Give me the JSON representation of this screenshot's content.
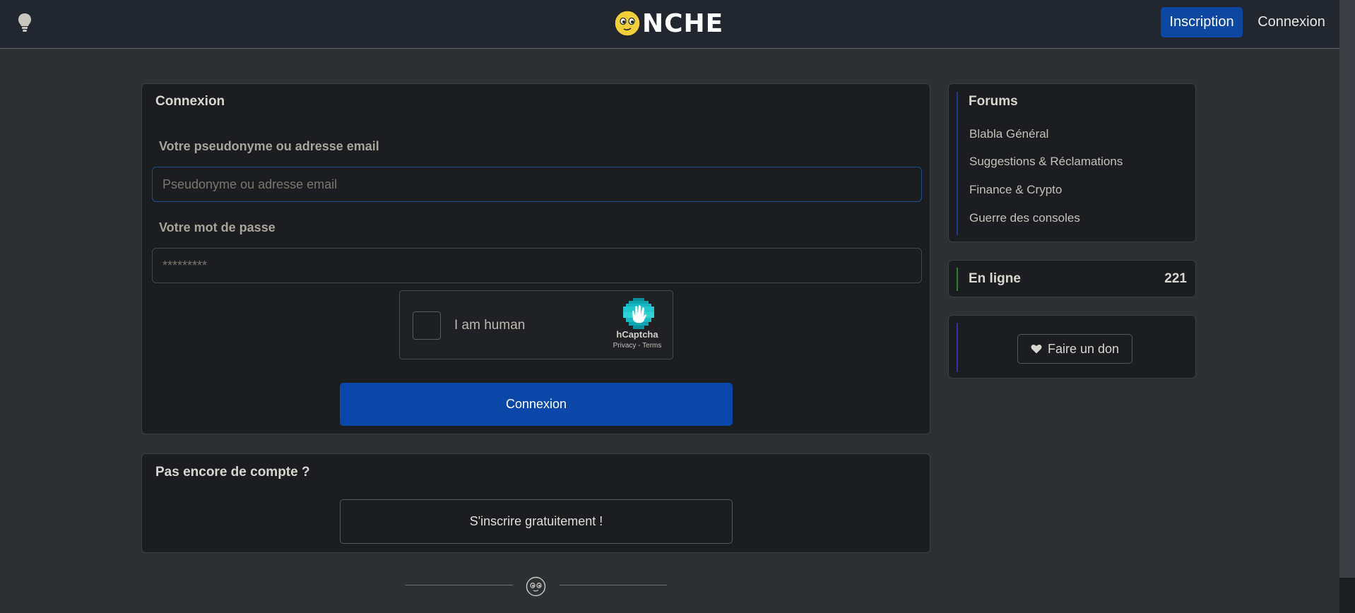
{
  "navbar": {
    "logo_text": "NCHE",
    "signup_label": "Inscription",
    "login_label": "Connexion"
  },
  "login_form": {
    "title": "Connexion",
    "username_label": "Votre pseudonyme ou adresse email",
    "username_placeholder": "Pseudonyme ou adresse email",
    "password_label": "Votre mot de passe",
    "password_placeholder": "*********",
    "submit_label": "Connexion"
  },
  "captcha": {
    "label": "I am human",
    "brand": "hCaptcha",
    "links": "Privacy - Terms"
  },
  "signup_box": {
    "title": "Pas encore de compte ?",
    "button_label": "S'inscrire gratuitement !"
  },
  "sidebar": {
    "forums_title": "Forums",
    "forums": [
      {
        "label": "Blabla Général"
      },
      {
        "label": "Suggestions & Réclamations"
      },
      {
        "label": "Finance & Crypto"
      },
      {
        "label": "Guerre des consoles"
      }
    ],
    "online_label": "En ligne",
    "online_count": "221",
    "donate_label": "Faire un don"
  },
  "colors": {
    "background": "#2e3134",
    "navbar": "#22272f",
    "card": "#1b1d20",
    "primary": "#0b47a8",
    "forums_accent": "#1e3a8a",
    "online_accent": "#2e7d32",
    "donate_accent": "#3730a3"
  },
  "icons": [
    "lightbulb-icon",
    "onche-logo-face-icon",
    "heart-icon",
    "hcaptcha-logo-icon",
    "onche-face-icon"
  ]
}
